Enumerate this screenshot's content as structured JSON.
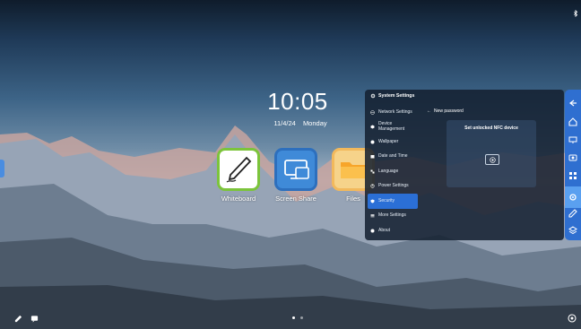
{
  "home": {
    "time": "10:05",
    "date": "11/4/24",
    "weekday": "Monday",
    "apps": [
      {
        "label": "Whiteboard",
        "icon": "whiteboard-pen-icon"
      },
      {
        "label": "Screen Share",
        "icon": "screen-share-icon"
      },
      {
        "label": "Files",
        "icon": "folder-icon"
      }
    ],
    "page_indicator": {
      "pages": 2,
      "current": 1
    }
  },
  "settings_panel": {
    "title": "System Settings",
    "menu": [
      {
        "label": "Network Settings",
        "icon": "network-icon",
        "active": false
      },
      {
        "label": "Device Management",
        "icon": "device-icon",
        "active": false
      },
      {
        "label": "Wallpaper",
        "icon": "wallpaper-icon",
        "active": false
      },
      {
        "label": "Date and Time",
        "icon": "calendar-icon",
        "active": false
      },
      {
        "label": "Language",
        "icon": "language-icon",
        "active": false
      },
      {
        "label": "Power Settings",
        "icon": "power-icon",
        "active": false
      },
      {
        "label": "Security",
        "icon": "security-icon",
        "active": true
      },
      {
        "label": "More Settings",
        "icon": "more-icon",
        "active": false
      },
      {
        "label": "About",
        "icon": "info-icon",
        "active": false
      }
    ],
    "back_label": "New password",
    "nfc_card_title": "Set unlocked NFC device"
  },
  "colors": {
    "accent": "#2b6fd6",
    "sidebar": "#2f6fd0",
    "whiteboard_border": "#7cc43b",
    "screen_share": "#3f8ad8",
    "files": "#f6d38a"
  }
}
